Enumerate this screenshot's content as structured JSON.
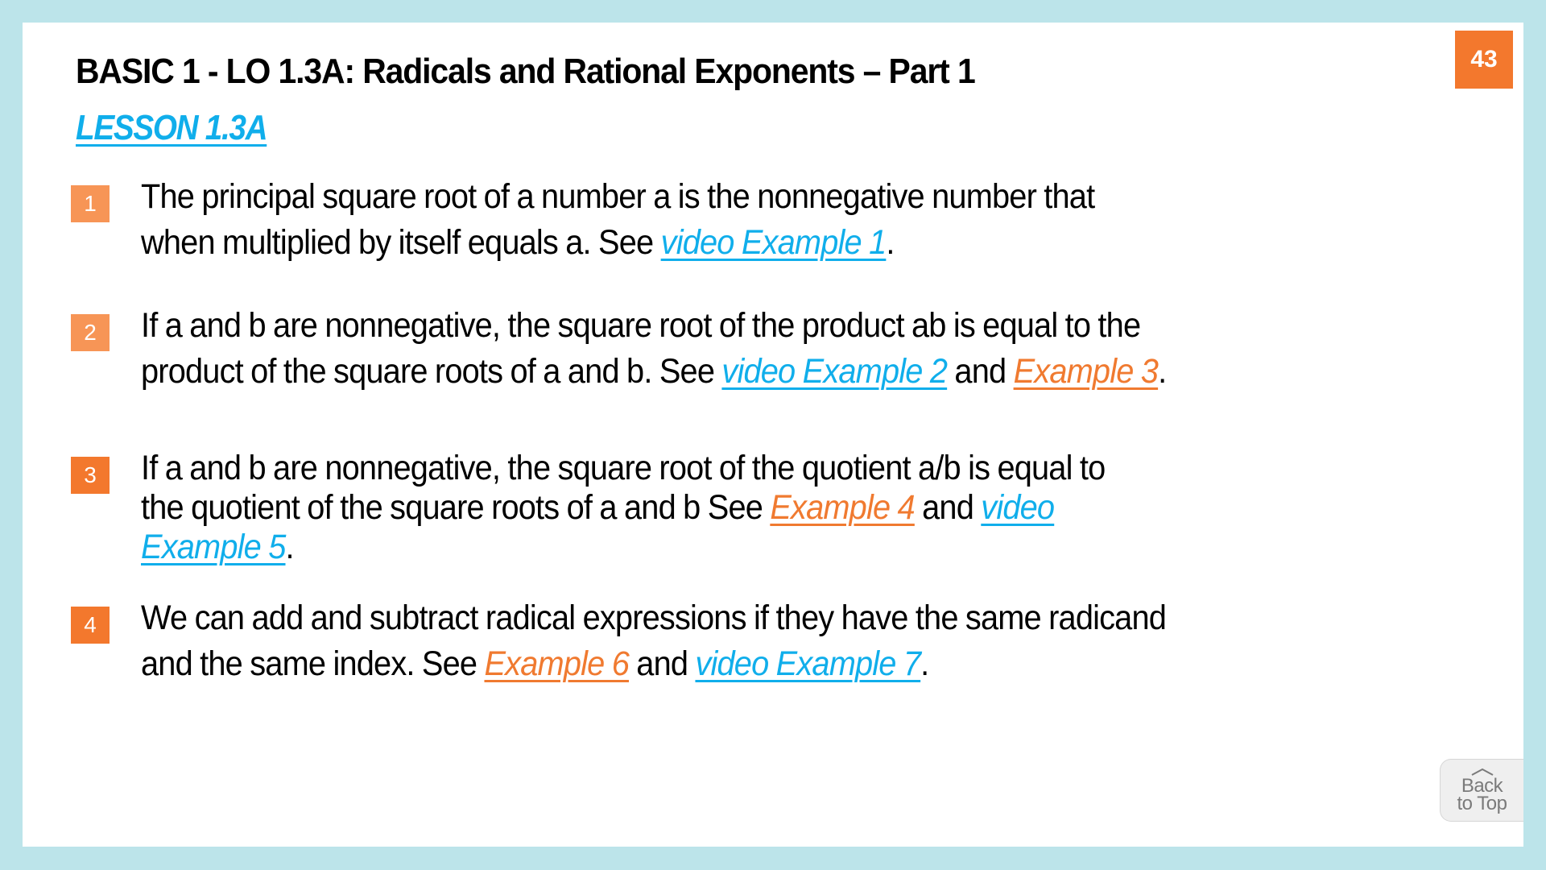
{
  "slide": {
    "title": "BASIC 1 - LO 1.3A: Radicals and Rational Exponents – Part 1",
    "lesson_link": "LESSON 1.3A",
    "page_number": "43",
    "colors": {
      "border": "#BCE4EA",
      "accent_orange": "#F3782D",
      "link_blue": "#10AEEB",
      "link_orange": "#F07A30"
    },
    "items": [
      {
        "number": "1",
        "line1": "The principal square root of a number a is the nonnegative number that",
        "line2_pre": "when multiplied by itself equals a. See ",
        "link1": "video Example 1",
        "line2_post": "."
      },
      {
        "number": "2",
        "line1": "If a and b are nonnegative, the square root of the product ab is equal to the",
        "line2_pre": "product of the square roots of a and b. See ",
        "link1": "video Example 2",
        "mid": " and ",
        "link2": "Example 3",
        "line2_post": "."
      },
      {
        "number": "3",
        "line1": "If a and b are nonnegative, the square root of the quotient a/b is equal to",
        "line2_pre": "the quotient of the square roots of a and b See ",
        "link1": "Example 4",
        "mid": " and ",
        "link2a": "video",
        "link2b": "Example 5",
        "line3_post": "."
      },
      {
        "number": "4",
        "line1": "We can add and subtract radical expressions if they have the same radicand",
        "line2_pre": "and the same index. See ",
        "link1": "Example 6",
        "mid": " and ",
        "link2": "video Example 7",
        "line2_post": "."
      }
    ],
    "back_to_top": {
      "icon": "caret-up-icon",
      "line1": "Back",
      "line2": "to Top"
    }
  }
}
